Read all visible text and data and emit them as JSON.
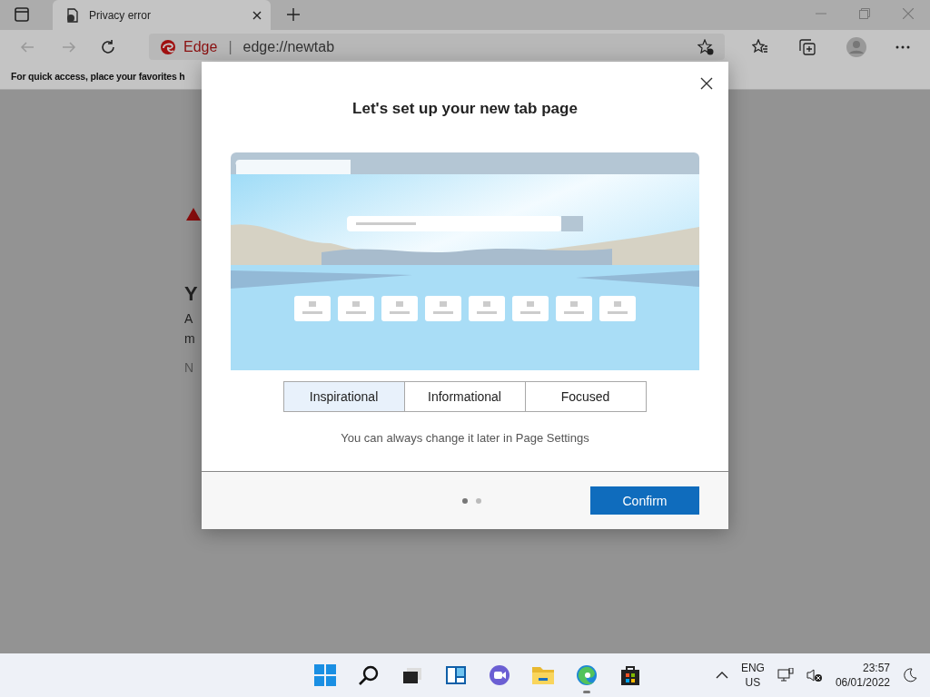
{
  "browser": {
    "tabs": [
      {
        "title": "Privacy error",
        "selected": true
      }
    ],
    "address_bar": {
      "site_label": "Edge",
      "separator": "|",
      "url": "edge://newtab"
    },
    "favorites_bar": {
      "hint": "For quick access, place your favorites h"
    }
  },
  "background_page": {
    "fragments": [
      {
        "kind": "heading",
        "text": "Y"
      },
      {
        "kind": "paragraph",
        "text": "A"
      },
      {
        "kind": "paragraph",
        "text": "m"
      },
      {
        "kind": "note",
        "text": "N"
      }
    ]
  },
  "dialog": {
    "title": "Let's set up your new tab page",
    "layouts": [
      {
        "label": "Inspirational",
        "selected": true
      },
      {
        "label": "Informational",
        "selected": false
      },
      {
        "label": "Focused",
        "selected": false
      }
    ],
    "hint": "You can always change it later in Page Settings",
    "steps": [
      {
        "selected": true
      },
      {
        "selected": false
      }
    ],
    "confirm": "Confirm"
  },
  "taskbar": {
    "apps": [
      {
        "kind": "start",
        "running": false
      },
      {
        "kind": "search",
        "running": false
      },
      {
        "kind": "taskview",
        "running": false
      },
      {
        "kind": "widgets",
        "running": false
      },
      {
        "kind": "chat",
        "running": false
      },
      {
        "kind": "files",
        "running": false
      },
      {
        "kind": "edge",
        "running": true
      },
      {
        "kind": "store",
        "running": false
      }
    ],
    "language": "ENG",
    "region": "US",
    "time": "23:57",
    "date": "06/01/2022"
  }
}
